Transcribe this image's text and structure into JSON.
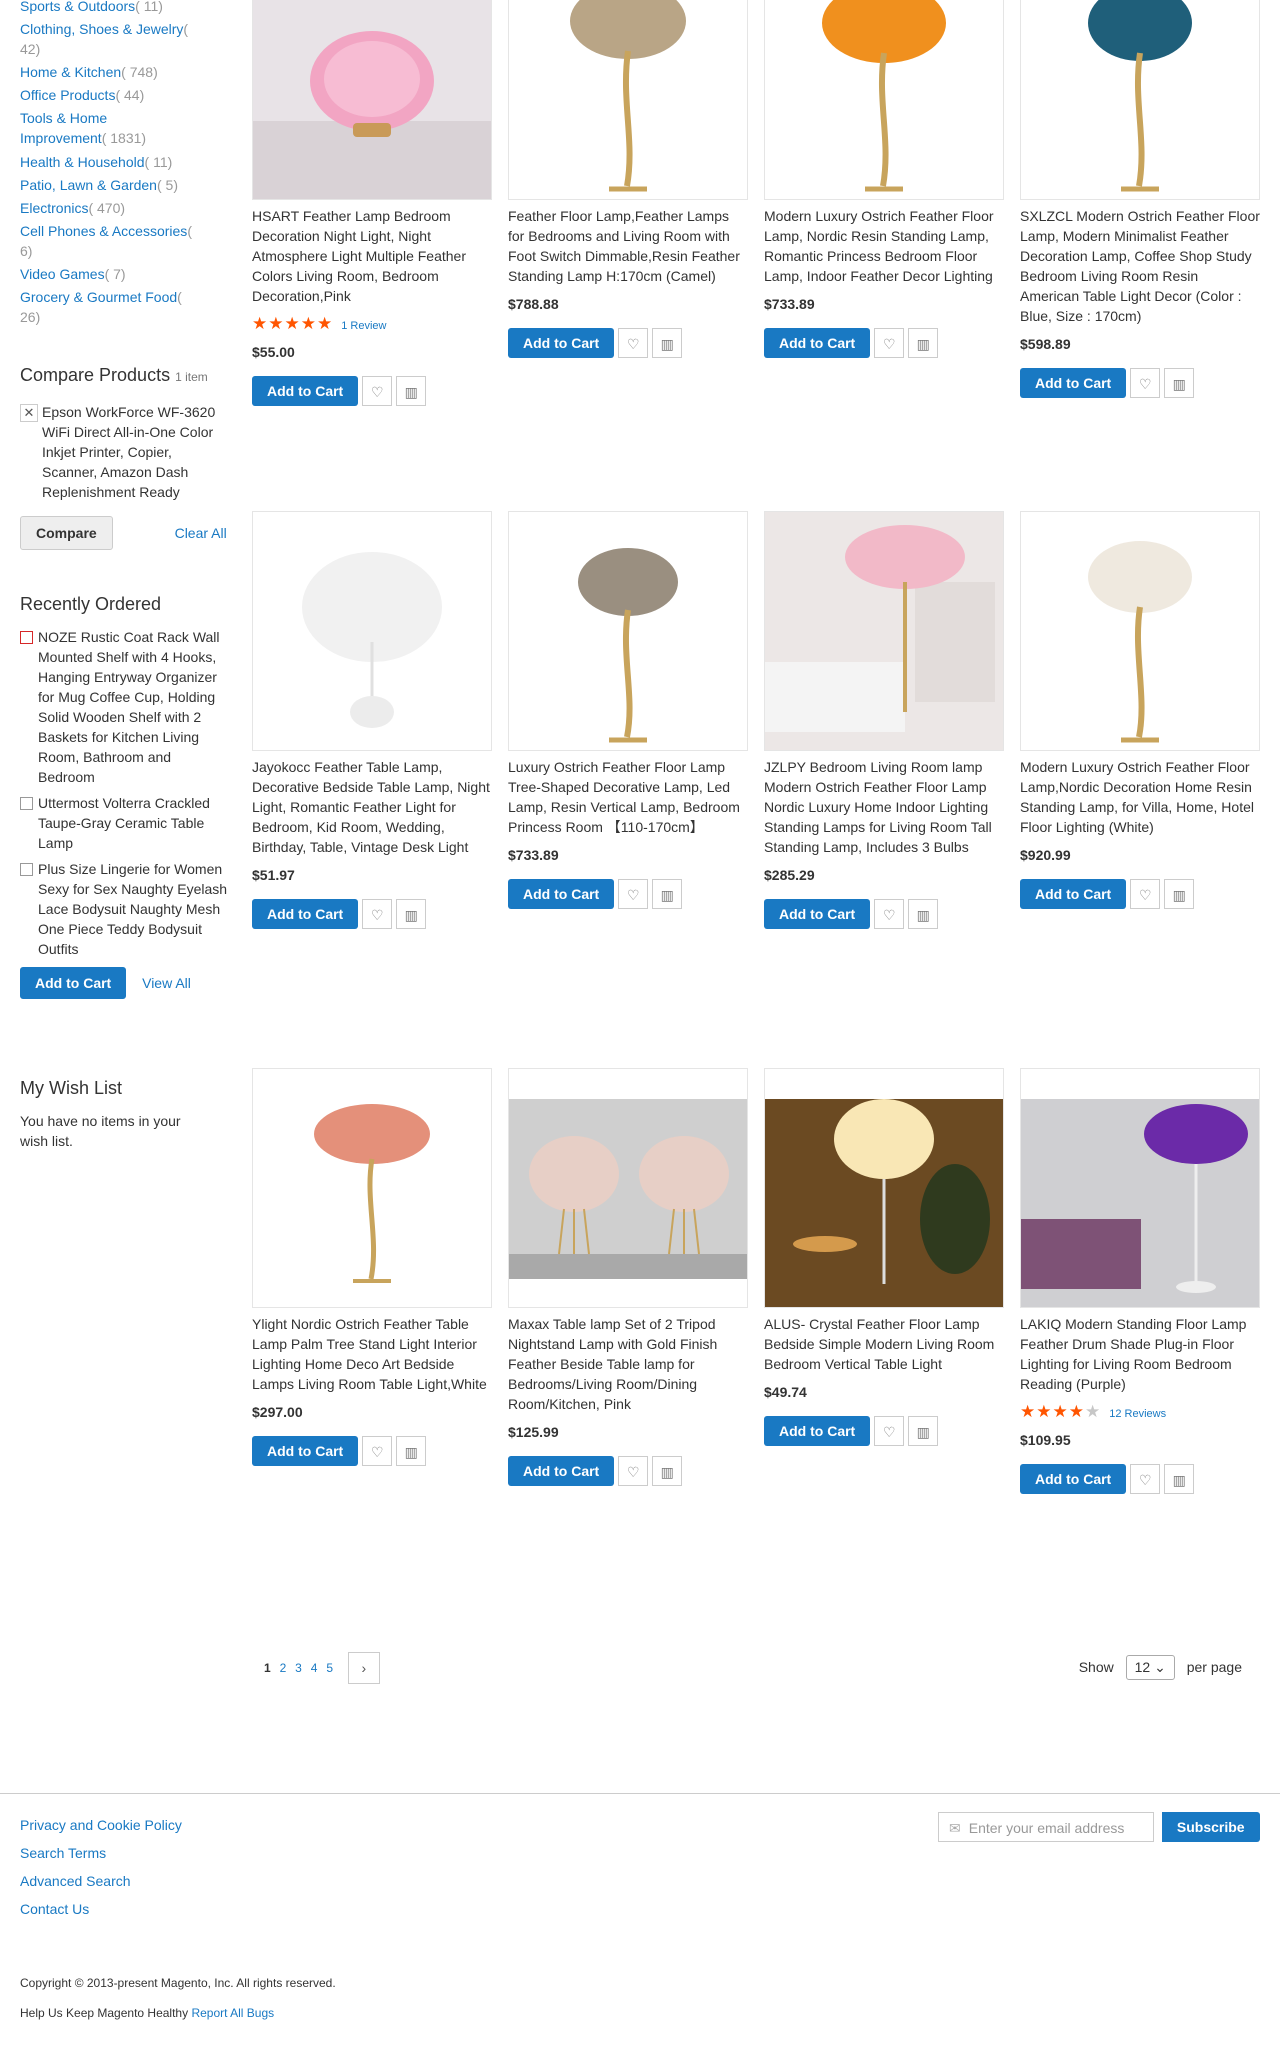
{
  "sidebar": {
    "categories": [
      {
        "label": "Sports & Outdoors",
        "count": "( 11)"
      },
      {
        "label": "Clothing, Shoes & Jewelry",
        "count": "( 42)"
      },
      {
        "label": "Home & Kitchen",
        "count": "( 748)"
      },
      {
        "label": "Office Products",
        "count": "( 44)"
      },
      {
        "label": "Tools & Home Improvement",
        "count": "( 1831)"
      },
      {
        "label": "Health & Household",
        "count": "( 11)"
      },
      {
        "label": "Patio, Lawn & Garden",
        "count": "( 5)"
      },
      {
        "label": "Electronics",
        "count": "( 470)"
      },
      {
        "label": "Cell Phones & Accessories",
        "count": "( 6)"
      },
      {
        "label": "Video Games",
        "count": "( 7)"
      },
      {
        "label": "Grocery & Gourmet Food",
        "count": "( 26)"
      }
    ],
    "compare": {
      "title": "Compare Products",
      "count": "1 item",
      "remove_glyph": "✕",
      "item": "Epson WorkForce WF-3620 WiFi Direct All-in-One Color Inkjet Printer, Copier, Scanner, Amazon Dash Replenishment Ready",
      "button": "Compare",
      "clear": "Clear All"
    },
    "recently_ordered": {
      "title": "Recently Ordered",
      "items": [
        "NOZE Rustic Coat Rack Wall Mounted Shelf with 4 Hooks, Hanging Entryway Organizer for Mug Coffee Cup, Holding Solid Wooden Shelf with 2 Baskets for Kitchen Living Room, Bathroom and Bedroom",
        "Uttermost Volterra Crackled Taupe-Gray Ceramic Table Lamp",
        "Plus Size Lingerie for Women Sexy for Sex Naughty Eyelash Lace Bodysuit Naughty Mesh One Piece Teddy Bodysuit Outfits"
      ],
      "add_to_cart": "Add to Cart",
      "view_all": "View All"
    },
    "wishlist": {
      "title": "My Wish List",
      "empty": "You have no items in your wish list."
    }
  },
  "products": [
    {
      "name": "HSART Feather Lamp Bedroom Decoration Night Light, Night Atmosphere Light Multiple Feather Colors Living Room, Bedroom Decoration,Pink",
      "stars": 5,
      "reviews": "1 Review",
      "price": "$55.00",
      "img": "pink-feather-ball-lamp"
    },
    {
      "name": "Feather Floor Lamp,Feather Lamps for Bedrooms and Living Room with Foot Switch Dimmable,Resin Feather Standing Lamp H:170cm (Camel)",
      "price": "$788.88",
      "img": "camel-ostrich-floor-lamp"
    },
    {
      "name": "Modern Luxury Ostrich Feather Floor Lamp, Nordic Resin Standing Lamp, Romantic Princess Bedroom Floor Lamp, Indoor Feather Decor Lighting",
      "price": "$733.89",
      "img": "orange-ostrich-floor-lamp"
    },
    {
      "name": "SXLZCL Modern Ostrich Feather Floor Lamp, Modern Minimalist Feather Decoration Lamp, Coffee Shop Study Bedroom Living Room Resin American Table Light Decor (Color : Blue, Size : 170cm)",
      "price": "$598.89",
      "img": "blue-ostrich-floor-lamp"
    },
    {
      "name": "Jayokocc Feather Table Lamp, Decorative Bedside Table Lamp, Night Light, Romantic Feather Light for Bedroom, Kid Room, Wedding, Birthday, Table, Vintage Desk Light",
      "price": "$51.97",
      "img": "white-feather-table-lamp"
    },
    {
      "name": "Luxury Ostrich Feather Floor Lamp Tree-Shaped Decorative Lamp, Led Lamp, Resin Vertical Lamp, Bedroom Princess Room 【110-170cm】",
      "price": "$733.89",
      "img": "grey-ostrich-floor-lamp"
    },
    {
      "name": "JZLPY Bedroom Living Room lamp Modern Ostrich Feather Floor Lamp Nordic Luxury Home Indoor Lighting Standing Lamps for Living Room Tall Standing Lamp, Includes 3 Bulbs",
      "price": "$285.29",
      "img": "pink-ostrich-living-room"
    },
    {
      "name": "Modern Luxury Ostrich Feather Floor Lamp,Nordic Decoration Home Resin Standing Lamp, for Villa, Home, Hotel Floor Lighting (White)",
      "price": "$920.99",
      "img": "white-ostrich-floor-lamp"
    },
    {
      "name": "Ylight Nordic Ostrich Feather Table Lamp Palm Tree Stand Light Interior Lighting Home Deco Art Bedside Lamps Living Room Table Light,White",
      "price": "$297.00",
      "img": "coral-ostrich-table-lamp"
    },
    {
      "name": "Maxax Table lamp Set of 2 Tripod Nightstand Lamp with Gold Finish Feather Beside Table lamp for Bedrooms/Living Room/Dining Room/Kitchen, Pink",
      "price": "$125.99",
      "img": "pink-feather-tripod-pair"
    },
    {
      "name": "ALUS- Crystal Feather Floor Lamp Bedside Simple Modern Living Room Bedroom Vertical Table Light",
      "price": "$49.74",
      "img": "white-feather-floor-lamp-room"
    },
    {
      "name": "LAKIQ Modern Standing Floor Lamp Feather Drum Shade Plug-in Floor Lighting for Living Room Bedroom Reading (Purple)",
      "stars": 4,
      "reviews": "12  Reviews",
      "price": "$109.95",
      "img": "purple-drum-floor-lamp"
    }
  ],
  "product_actions": {
    "add_to_cart": "Add to Cart"
  },
  "toolbar": {
    "pages": [
      "1",
      "2",
      "3",
      "4",
      "5"
    ],
    "current_page": "1",
    "show": "Show",
    "limit": "12",
    "per_page": "per page"
  },
  "footer": {
    "links": [
      "Privacy and Cookie Policy",
      "Search Terms",
      "Advanced Search",
      "Contact Us"
    ],
    "newsletter_placeholder": "Enter your email address",
    "subscribe": "Subscribe",
    "copyright": "Copyright © 2013-present Magento, Inc. All rights reserved.",
    "help_text": "Help Us Keep Magento Healthy",
    "report_bugs": "Report All Bugs"
  },
  "colors": {
    "accent": "#1979c3",
    "star": "#ff5501"
  }
}
